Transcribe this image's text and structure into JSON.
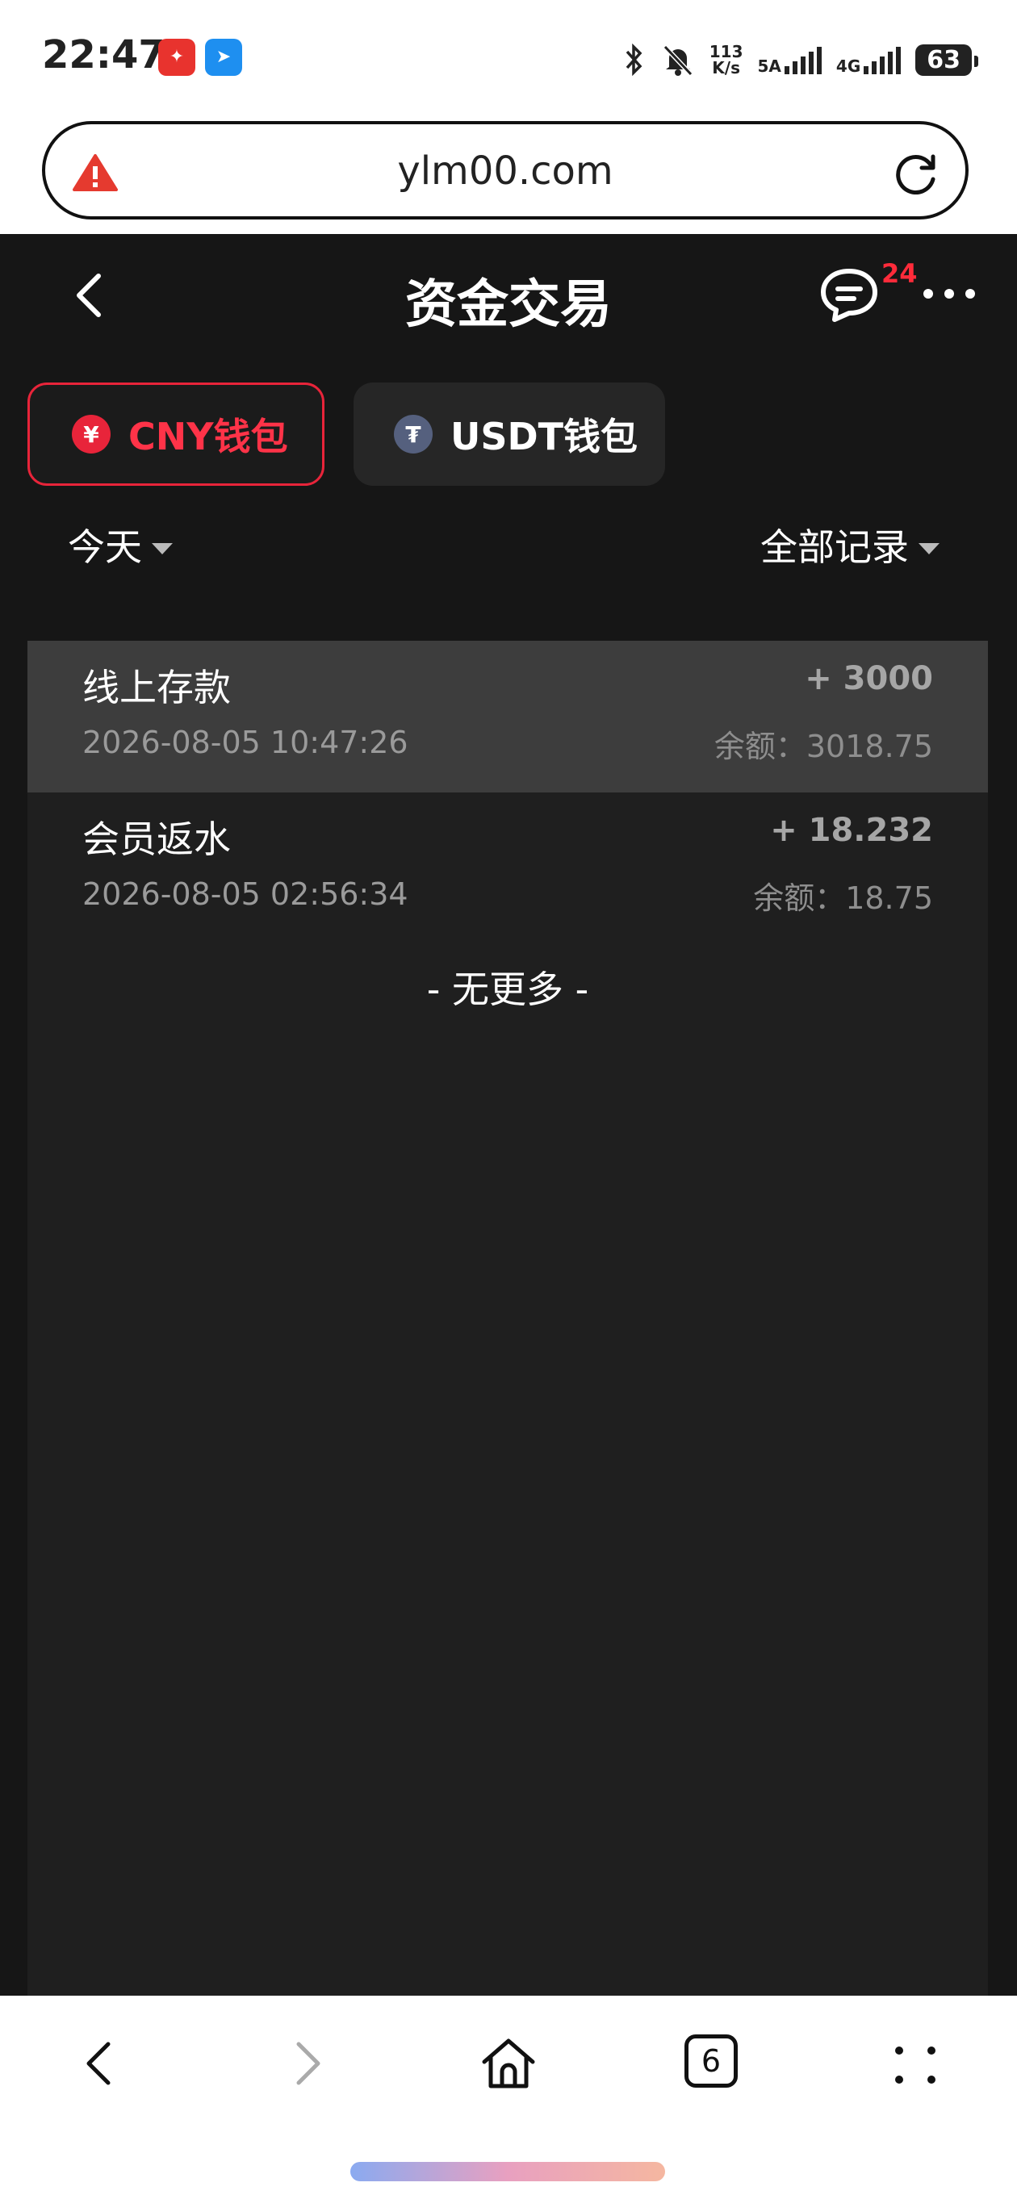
{
  "status_bar": {
    "time": "22:47",
    "net_speed_value": "113",
    "net_speed_unit": "K/s",
    "network_5a": "5A",
    "network_4g": "4G",
    "battery": "63"
  },
  "browser": {
    "url": "ylm00.com",
    "tabs_count": "6"
  },
  "page": {
    "title": "资金交易",
    "message_badge": "24"
  },
  "wallet_tabs": [
    {
      "label": "CNY钱包",
      "icon": "yuan-coin-icon",
      "symbol": "¥",
      "active": true
    },
    {
      "label": "USDT钱包",
      "icon": "tether-coin-icon",
      "symbol": "₮",
      "active": false
    }
  ],
  "filters": {
    "date": "今天",
    "type": "全部记录"
  },
  "transactions": [
    {
      "title": "线上存款",
      "time": "2026-08-05 10:47:26",
      "amount": "+ 3000",
      "balance": "余额：3018.75"
    },
    {
      "title": "会员返水",
      "time": "2026-08-05 02:56:34",
      "amount": "+ 18.232",
      "balance": "余额：18.75"
    }
  ],
  "list_end_text": "- 无更多 -",
  "colors": {
    "accent_red": "#e8243a",
    "app_background": "#161616",
    "list_background": "#1f1f1f",
    "highlight_row": "#3d3d3d"
  }
}
